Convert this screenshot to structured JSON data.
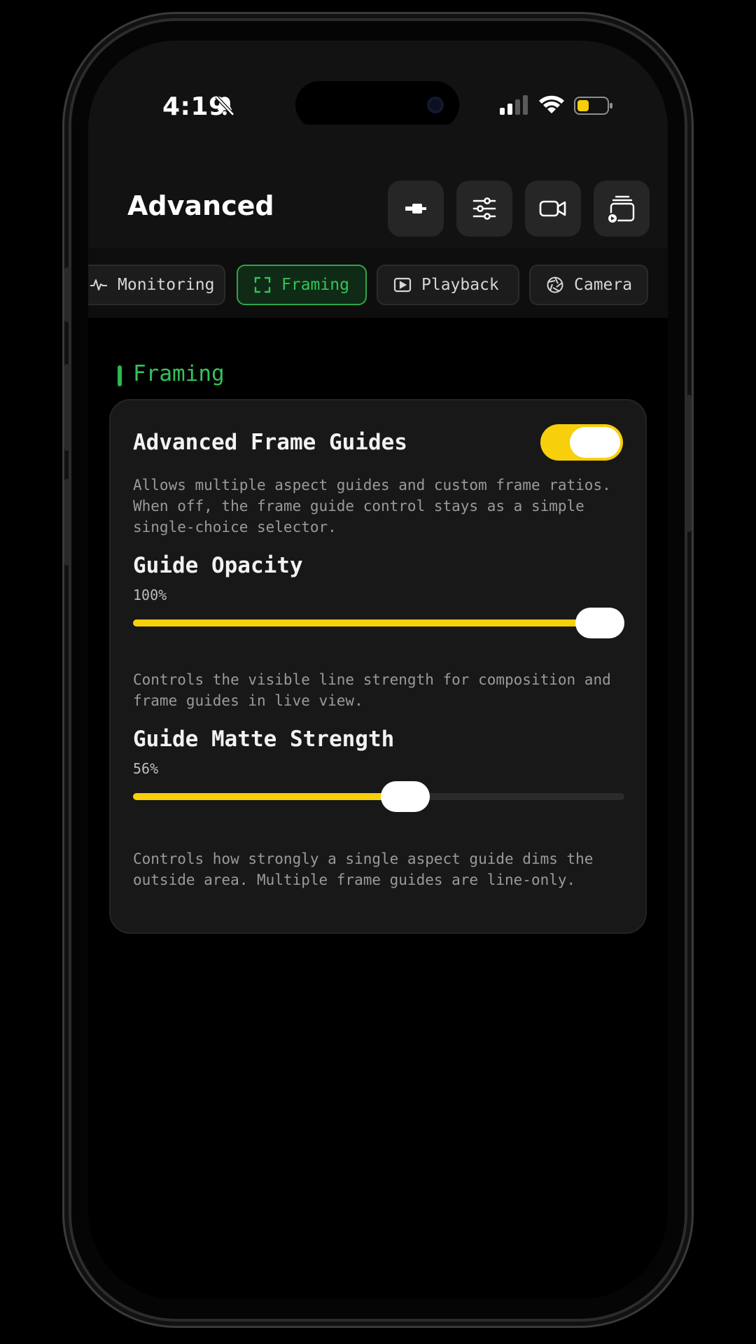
{
  "status": {
    "time": "4:19"
  },
  "header": {
    "title": "Advanced",
    "buttons": [
      "connector-icon",
      "sliders-icon",
      "video-camera-icon",
      "playback-stack-icon"
    ]
  },
  "tabs": [
    {
      "label": "Monitoring",
      "icon": "pulse-icon",
      "active": false
    },
    {
      "label": "Framing",
      "icon": "frame-corners-icon",
      "active": true
    },
    {
      "label": "Playback",
      "icon": "play-box-icon",
      "active": false
    },
    {
      "label": "Camera",
      "icon": "aperture-icon",
      "active": false
    }
  ],
  "section": {
    "title": "Framing"
  },
  "settings": {
    "frame_guides": {
      "title": "Advanced Frame Guides",
      "enabled": true,
      "description": "Allows multiple aspect guides and custom frame ratios. When off, the frame guide control stays as a simple single-choice selector."
    },
    "guide_opacity": {
      "title": "Guide Opacity",
      "value_label": "100%",
      "value": 100,
      "description": "Controls the visible line strength for composition and frame guides in live view."
    },
    "matte_strength": {
      "title": "Guide Matte Strength",
      "value_label": "56%",
      "value": 56,
      "description": "Controls how strongly a single aspect guide dims the outside area. Multiple frame guides are line-only."
    }
  },
  "colors": {
    "accent": "#f7cf0a",
    "active_tab": "#33c35a",
    "card": "#181818"
  }
}
